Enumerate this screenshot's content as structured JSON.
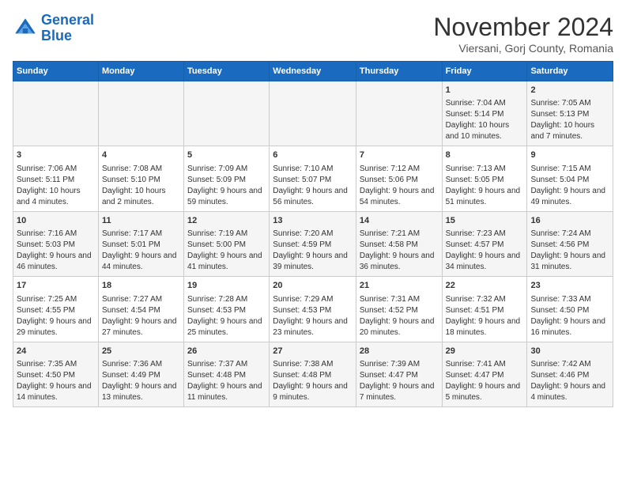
{
  "header": {
    "logo_line1": "General",
    "logo_line2": "Blue",
    "month": "November 2024",
    "location": "Viersani, Gorj County, Romania"
  },
  "days_of_week": [
    "Sunday",
    "Monday",
    "Tuesday",
    "Wednesday",
    "Thursday",
    "Friday",
    "Saturday"
  ],
  "weeks": [
    [
      {
        "day": "",
        "info": ""
      },
      {
        "day": "",
        "info": ""
      },
      {
        "day": "",
        "info": ""
      },
      {
        "day": "",
        "info": ""
      },
      {
        "day": "",
        "info": ""
      },
      {
        "day": "1",
        "info": "Sunrise: 7:04 AM\nSunset: 5:14 PM\nDaylight: 10 hours and 10 minutes."
      },
      {
        "day": "2",
        "info": "Sunrise: 7:05 AM\nSunset: 5:13 PM\nDaylight: 10 hours and 7 minutes."
      }
    ],
    [
      {
        "day": "3",
        "info": "Sunrise: 7:06 AM\nSunset: 5:11 PM\nDaylight: 10 hours and 4 minutes."
      },
      {
        "day": "4",
        "info": "Sunrise: 7:08 AM\nSunset: 5:10 PM\nDaylight: 10 hours and 2 minutes."
      },
      {
        "day": "5",
        "info": "Sunrise: 7:09 AM\nSunset: 5:09 PM\nDaylight: 9 hours and 59 minutes."
      },
      {
        "day": "6",
        "info": "Sunrise: 7:10 AM\nSunset: 5:07 PM\nDaylight: 9 hours and 56 minutes."
      },
      {
        "day": "7",
        "info": "Sunrise: 7:12 AM\nSunset: 5:06 PM\nDaylight: 9 hours and 54 minutes."
      },
      {
        "day": "8",
        "info": "Sunrise: 7:13 AM\nSunset: 5:05 PM\nDaylight: 9 hours and 51 minutes."
      },
      {
        "day": "9",
        "info": "Sunrise: 7:15 AM\nSunset: 5:04 PM\nDaylight: 9 hours and 49 minutes."
      }
    ],
    [
      {
        "day": "10",
        "info": "Sunrise: 7:16 AM\nSunset: 5:03 PM\nDaylight: 9 hours and 46 minutes."
      },
      {
        "day": "11",
        "info": "Sunrise: 7:17 AM\nSunset: 5:01 PM\nDaylight: 9 hours and 44 minutes."
      },
      {
        "day": "12",
        "info": "Sunrise: 7:19 AM\nSunset: 5:00 PM\nDaylight: 9 hours and 41 minutes."
      },
      {
        "day": "13",
        "info": "Sunrise: 7:20 AM\nSunset: 4:59 PM\nDaylight: 9 hours and 39 minutes."
      },
      {
        "day": "14",
        "info": "Sunrise: 7:21 AM\nSunset: 4:58 PM\nDaylight: 9 hours and 36 minutes."
      },
      {
        "day": "15",
        "info": "Sunrise: 7:23 AM\nSunset: 4:57 PM\nDaylight: 9 hours and 34 minutes."
      },
      {
        "day": "16",
        "info": "Sunrise: 7:24 AM\nSunset: 4:56 PM\nDaylight: 9 hours and 31 minutes."
      }
    ],
    [
      {
        "day": "17",
        "info": "Sunrise: 7:25 AM\nSunset: 4:55 PM\nDaylight: 9 hours and 29 minutes."
      },
      {
        "day": "18",
        "info": "Sunrise: 7:27 AM\nSunset: 4:54 PM\nDaylight: 9 hours and 27 minutes."
      },
      {
        "day": "19",
        "info": "Sunrise: 7:28 AM\nSunset: 4:53 PM\nDaylight: 9 hours and 25 minutes."
      },
      {
        "day": "20",
        "info": "Sunrise: 7:29 AM\nSunset: 4:53 PM\nDaylight: 9 hours and 23 minutes."
      },
      {
        "day": "21",
        "info": "Sunrise: 7:31 AM\nSunset: 4:52 PM\nDaylight: 9 hours and 20 minutes."
      },
      {
        "day": "22",
        "info": "Sunrise: 7:32 AM\nSunset: 4:51 PM\nDaylight: 9 hours and 18 minutes."
      },
      {
        "day": "23",
        "info": "Sunrise: 7:33 AM\nSunset: 4:50 PM\nDaylight: 9 hours and 16 minutes."
      }
    ],
    [
      {
        "day": "24",
        "info": "Sunrise: 7:35 AM\nSunset: 4:50 PM\nDaylight: 9 hours and 14 minutes."
      },
      {
        "day": "25",
        "info": "Sunrise: 7:36 AM\nSunset: 4:49 PM\nDaylight: 9 hours and 13 minutes."
      },
      {
        "day": "26",
        "info": "Sunrise: 7:37 AM\nSunset: 4:48 PM\nDaylight: 9 hours and 11 minutes."
      },
      {
        "day": "27",
        "info": "Sunrise: 7:38 AM\nSunset: 4:48 PM\nDaylight: 9 hours and 9 minutes."
      },
      {
        "day": "28",
        "info": "Sunrise: 7:39 AM\nSunset: 4:47 PM\nDaylight: 9 hours and 7 minutes."
      },
      {
        "day": "29",
        "info": "Sunrise: 7:41 AM\nSunset: 4:47 PM\nDaylight: 9 hours and 5 minutes."
      },
      {
        "day": "30",
        "info": "Sunrise: 7:42 AM\nSunset: 4:46 PM\nDaylight: 9 hours and 4 minutes."
      }
    ]
  ]
}
